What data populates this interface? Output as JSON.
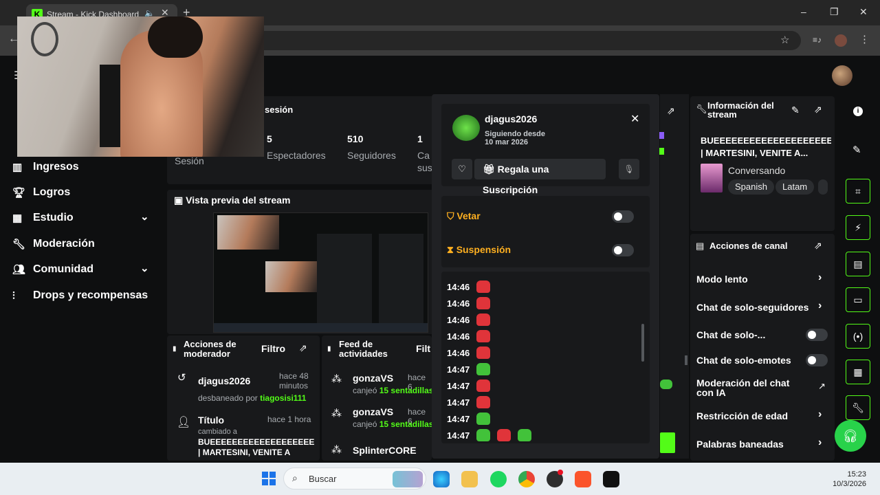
{
  "browser": {
    "tab_title": "Stream - Kick Dashboard",
    "tab_logo": "K",
    "new_tab": "+",
    "close_tab": "✕",
    "win_min": "–",
    "win_max": "❐",
    "win_close": "✕"
  },
  "sidebar": {
    "items": [
      {
        "label": "Ingresos",
        "icon": "chart-icon"
      },
      {
        "label": "Logros",
        "icon": "trophy-icon"
      },
      {
        "label": "Estudio",
        "icon": "studio-icon",
        "chevron": "⌄"
      },
      {
        "label": "Moderación",
        "icon": "wrench-icon"
      },
      {
        "label": "Comunidad",
        "icon": "community-icon",
        "chevron": "⌄"
      },
      {
        "label": "Drops y recompensas",
        "icon": "drops-icon"
      }
    ]
  },
  "session": {
    "title": "sesión",
    "stats": [
      {
        "value": "",
        "label": "Sesión"
      },
      {
        "value": "5",
        "label": "Espectadores"
      },
      {
        "value": "510",
        "label": "Seguidores"
      },
      {
        "value": "1",
        "label": "Ca"
      },
      {
        "label2": "sus"
      }
    ]
  },
  "preview": {
    "title": "Vista previa del stream"
  },
  "mod_actions": {
    "title_line1": "Acciones de",
    "title_line2": "moderador",
    "filter": "Filtro",
    "entries": [
      {
        "user": "djagus2026",
        "time1": "hace 48",
        "time2": "minutos",
        "action": "desbaneado por",
        "by": "tiagosisi111"
      },
      {
        "user": "Título",
        "time1": "hace 1 hora",
        "action": "cambiado a",
        "value1": "BUEEEEEEEEEEEEEEEEEEEEEI",
        "value2": "| MARTESINI, VENITE A"
      }
    ]
  },
  "feed": {
    "title_line1": "Feed de",
    "title_line2": "actividades",
    "filter": "Filt",
    "entries": [
      {
        "user": "gonzaVS",
        "time": "hace 6",
        "action": "canjeó",
        "item": "15 sentadillas"
      },
      {
        "user": "gonzaVS",
        "time": "hace 6",
        "action": "canjeó",
        "item": "15 sentadillas"
      },
      {
        "user": "SplinterCORE"
      }
    ]
  },
  "user_popup": {
    "username": "djagus2026",
    "since_label": "Siguiendo desde",
    "since_date": "10 mar 2026",
    "close": "✕",
    "gift_label": "Regala una Suscripción",
    "mod_options": [
      {
        "label": "Vetar",
        "on": false
      },
      {
        "label": "Suspensión",
        "on": false
      }
    ],
    "messages": [
      {
        "time": "14:46",
        "emotes": [
          "red"
        ]
      },
      {
        "time": "14:46",
        "emotes": [
          "red"
        ]
      },
      {
        "time": "14:46",
        "emotes": [
          "red"
        ]
      },
      {
        "time": "14:46",
        "emotes": [
          "red"
        ]
      },
      {
        "time": "14:46",
        "emotes": [
          "red"
        ]
      },
      {
        "time": "14:47",
        "emotes": [
          "green"
        ]
      },
      {
        "time": "14:47",
        "emotes": [
          "red"
        ]
      },
      {
        "time": "14:47",
        "emotes": [
          "red"
        ]
      },
      {
        "time": "14:47",
        "emotes": [
          "green"
        ]
      },
      {
        "time": "14:47",
        "emotes": [
          "green",
          "red",
          "green"
        ]
      }
    ],
    "colors": {
      "warn": "#ffb020",
      "red_emote": "#e0343a",
      "green_emote": "#42c23a"
    }
  },
  "stream_info": {
    "title_line1": "Información del",
    "title_line2": "stream",
    "stream_title_1": "BUEEEEEEEEEEEEEEEEEEEEEI",
    "stream_title_2": "| MARTESINI, VENITE A...",
    "category": "Conversando",
    "tags": [
      "Spanish",
      "Latam"
    ]
  },
  "channel_actions": {
    "title": "Acciones de canal",
    "items": [
      {
        "label": "Modo lento",
        "type": "arrow"
      },
      {
        "label": "Chat de solo-seguidores",
        "type": "arrow"
      },
      {
        "label": "Chat de solo-...",
        "type": "toggle",
        "on": false
      },
      {
        "label": "Chat de solo-emotes",
        "type": "toggle",
        "on": false
      },
      {
        "label": "Moderación del chat con IA",
        "type": "external"
      },
      {
        "label": "Restricción de edad",
        "type": "arrow"
      },
      {
        "label": "Palabras baneadas",
        "type": "arrow"
      }
    ]
  },
  "taskbar": {
    "search_placeholder": "Buscar",
    "time": "15:23",
    "date": "10/3/2026"
  },
  "accent": "#53fc18"
}
